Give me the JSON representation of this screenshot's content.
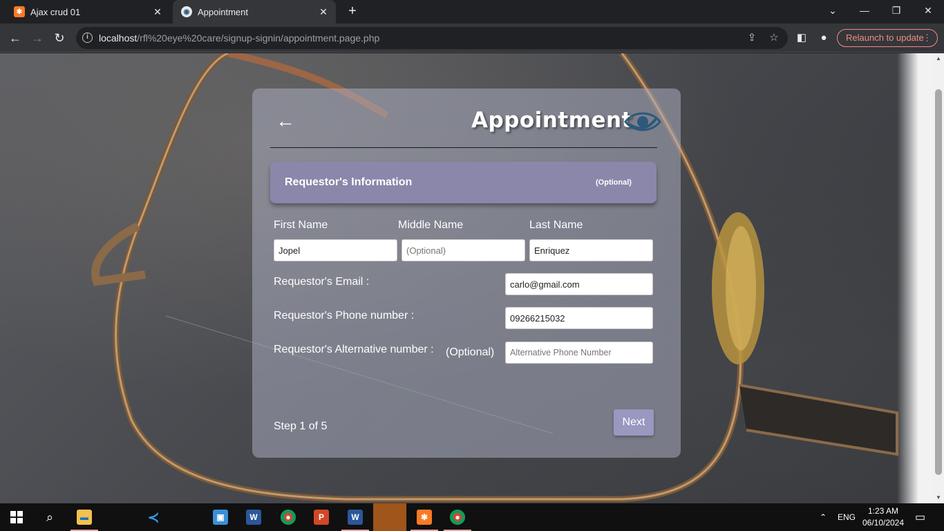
{
  "browser": {
    "tabs": [
      {
        "title": "Ajax crud 01",
        "icon": "xampp-icon"
      },
      {
        "title": "Appointment",
        "icon": "eye-logo-icon",
        "active": true
      }
    ],
    "url_host": "localhost",
    "url_path": "/rfl%20eye%20care/signup-signin/appointment.page.php",
    "relaunch_label": "Relaunch to update"
  },
  "form": {
    "title": "Appointment",
    "section_title": "Requestor's Information",
    "section_optional": "(Optional)",
    "labels": {
      "first_name": "First Name",
      "middle_name": "Middle Name",
      "last_name": "Last Name",
      "email": "Requestor's Email :",
      "phone": "Requestor's Phone number :",
      "alt_phone": "Requestor's Alternative number :",
      "alt_optional": "(Optional)"
    },
    "values": {
      "first_name": "Jopel",
      "middle_name": "",
      "last_name": "Enriquez",
      "email": "carlo@gmail.com",
      "phone": "09266215032",
      "alt_phone": ""
    },
    "placeholders": {
      "middle_name": "(Optional)",
      "alt_phone": "Alternative Phone Number"
    },
    "step_text": "Step 1 of 5",
    "next_label": "Next"
  },
  "taskbar": {
    "apps": [
      "start-icon",
      "search-icon",
      "file-explorer-icon",
      "vscode-icon",
      "remote-desktop-icon",
      "word-icon",
      "chrome-icon",
      "powerpoint-icon",
      "word-icon",
      "xampp-active",
      "xampp-icon",
      "chrome-icon"
    ],
    "language": "ENG",
    "time": "1:23 AM",
    "date": "06/10/2024"
  },
  "colors": {
    "section_bar": "#8a87ab",
    "next_button": "#9a97c0",
    "relaunch": "#f28b82",
    "active_taskbar": "#a0551b"
  }
}
